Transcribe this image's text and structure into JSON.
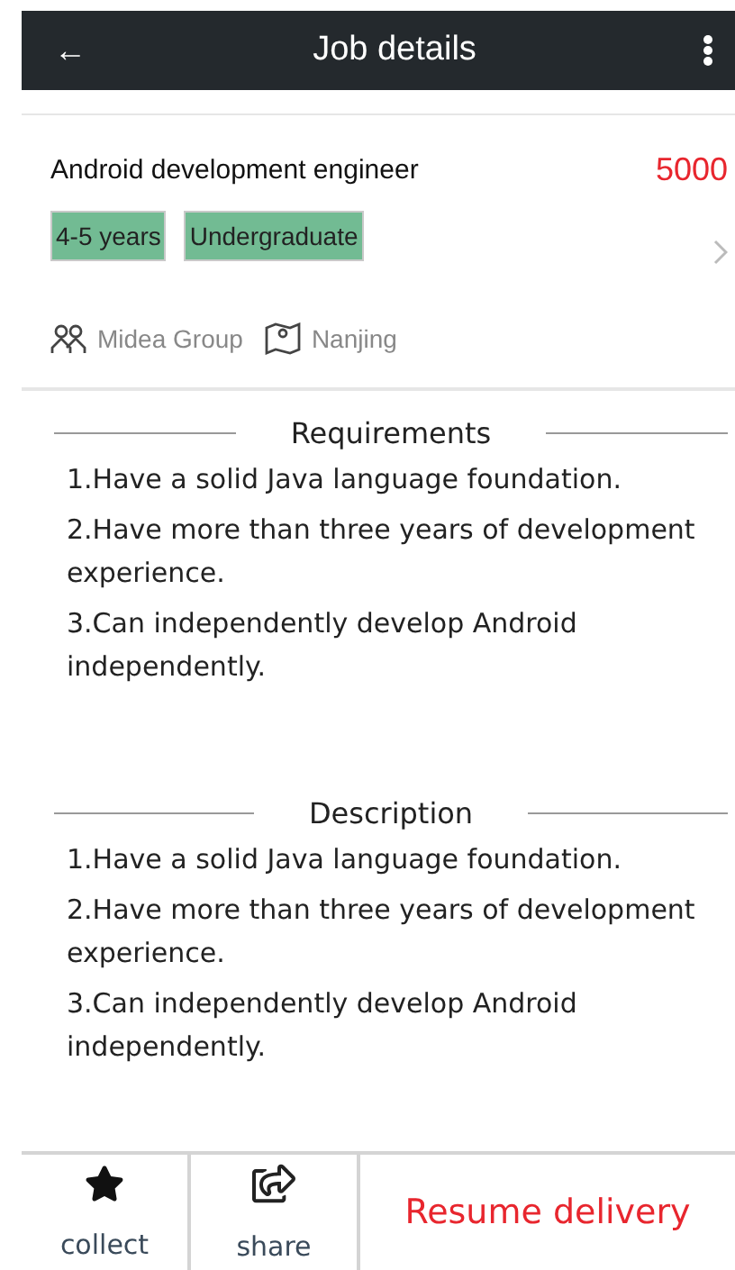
{
  "header": {
    "back": "←",
    "title": "Job details"
  },
  "job": {
    "title": "Android development engineer",
    "salary": "5000",
    "tags": [
      "4-5 years",
      "Undergraduate"
    ],
    "company": "Midea Group",
    "city": "Nanjing"
  },
  "sections": [
    {
      "heading": "Requirements",
      "items": [
        "1.Have a solid Java language foundation.",
        "2.Have more than three years of development experience.",
        "3.Can independently develop Android independently."
      ]
    },
    {
      "heading": "Description",
      "items": [
        "1.Have a solid Java language foundation.",
        "2.Have more than three years of development experience.",
        "3.Can independently develop Android independently."
      ]
    }
  ],
  "bottom_bar": {
    "collect": "collect",
    "share": "share",
    "apply": "Resume delivery"
  }
}
